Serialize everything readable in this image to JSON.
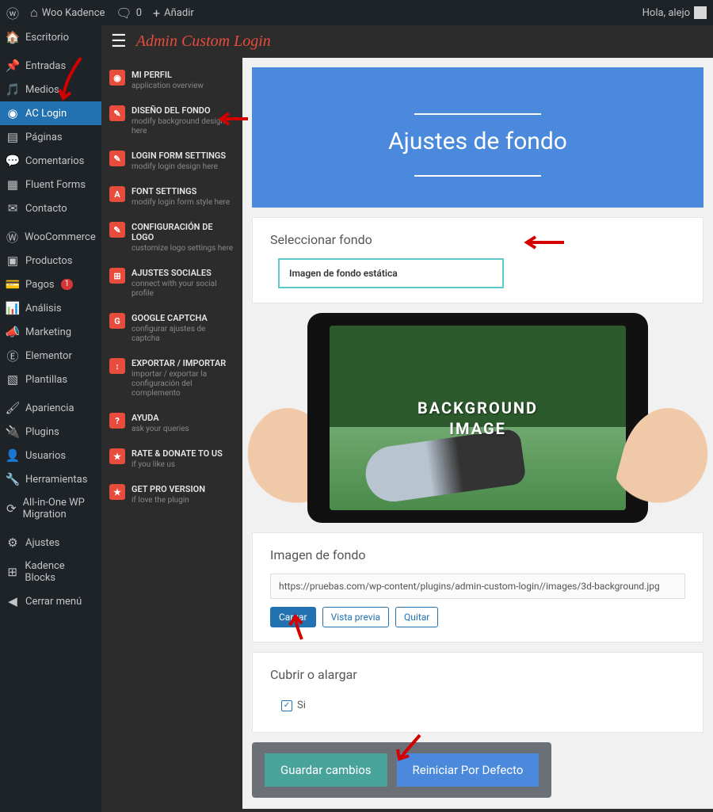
{
  "topbar": {
    "site_name": "Woo Kadence",
    "comments_count": "0",
    "add_new": "Añadir",
    "greeting": "Hola, alejo"
  },
  "wp_menu": [
    {
      "icon": "dashboard",
      "label": "Escritorio"
    },
    {
      "icon": "pin",
      "label": "Entradas"
    },
    {
      "icon": "media",
      "label": "Medios"
    },
    {
      "icon": "ac",
      "label": "AC Login",
      "active": true
    },
    {
      "icon": "page",
      "label": "Páginas"
    },
    {
      "icon": "comment",
      "label": "Comentarios"
    },
    {
      "icon": "form",
      "label": "Fluent Forms"
    },
    {
      "icon": "mail",
      "label": "Contacto"
    },
    {
      "icon": "woo",
      "label": "WooCommerce"
    },
    {
      "icon": "product",
      "label": "Productos"
    },
    {
      "icon": "pay",
      "label": "Pagos",
      "badge": "1"
    },
    {
      "icon": "chart",
      "label": "Análisis"
    },
    {
      "icon": "marketing",
      "label": "Marketing"
    },
    {
      "icon": "elementor",
      "label": "Elementor"
    },
    {
      "icon": "template",
      "label": "Plantillas"
    },
    {
      "icon": "brush",
      "label": "Apariencia"
    },
    {
      "icon": "plugin",
      "label": "Plugins"
    },
    {
      "icon": "user",
      "label": "Usuarios"
    },
    {
      "icon": "tool",
      "label": "Herramientas"
    },
    {
      "icon": "migrate",
      "label": "All-in-One WP Migration"
    },
    {
      "icon": "settings",
      "label": "Ajustes"
    },
    {
      "icon": "kadence",
      "label": "Kadence Blocks"
    },
    {
      "icon": "collapse",
      "label": "Cerrar menú"
    }
  ],
  "plugin": {
    "title": "Admin Custom Login",
    "nav": [
      {
        "icon": "◉",
        "label": "MI PERFIL",
        "desc": "application overview"
      },
      {
        "icon": "✎",
        "label": "DISEÑO DEL FONDO",
        "desc": "modify background design here"
      },
      {
        "icon": "✎",
        "label": "LOGIN FORM SETTINGS",
        "desc": "modify login design here"
      },
      {
        "icon": "A",
        "label": "FONT SETTINGS",
        "desc": "modify login form style here"
      },
      {
        "icon": "✎",
        "label": "CONFIGURACIÓN DE LOGO",
        "desc": "customize logo settings here"
      },
      {
        "icon": "⊞",
        "label": "AJUSTES SOCIALES",
        "desc": "connect with your social profile"
      },
      {
        "icon": "G",
        "label": "GOOGLE CAPTCHA",
        "desc": "configurar ajustes de captcha"
      },
      {
        "icon": "↕",
        "label": "EXPORTAR / IMPORTAR",
        "desc": "importar / exportar la configuración del complemento"
      },
      {
        "icon": "?",
        "label": "AYUDA",
        "desc": "ask your queries"
      },
      {
        "icon": "★",
        "label": "RATE & DONATE TO US",
        "desc": "if you like us"
      },
      {
        "icon": "★",
        "label": "GET PRO VERSION",
        "desc": "if love the plugin"
      }
    ]
  },
  "content": {
    "hero_title": "Ajustes de fondo",
    "select_bg_label": "Seleccionar fondo",
    "select_value": "Imagen de fondo estática",
    "preview_text_1": "BACKGROUND",
    "preview_text_2": "IMAGE",
    "image_bg_label": "Imagen de fondo",
    "image_url": "https://pruebas.com/wp-content/plugins/admin-custom-login//images/3d-background.jpg",
    "btn_upload": "Cargar",
    "btn_preview": "Vista previa",
    "btn_remove": "Quitar",
    "cover_label": "Cubrir o alargar",
    "cover_yes": "Si",
    "save_btn": "Guardar cambios",
    "reset_btn": "Reiniciar Por Defecto"
  }
}
